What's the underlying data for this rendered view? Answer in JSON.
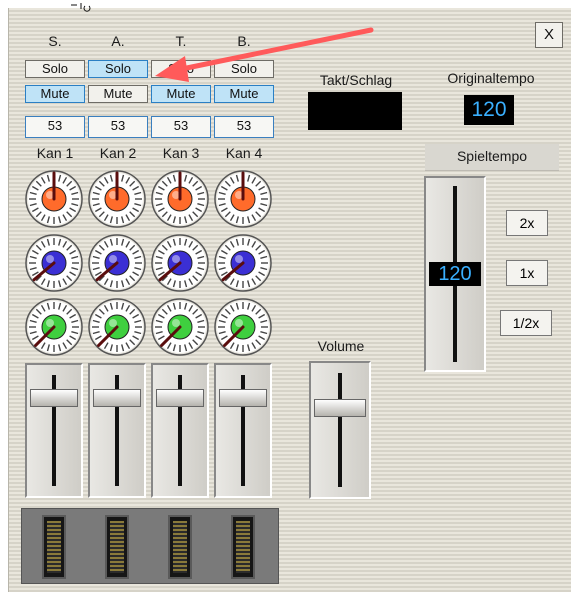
{
  "close_label": "X",
  "channels": [
    {
      "voice": "S.",
      "solo": "Solo",
      "mute": "Mute",
      "value": "53",
      "name": "Kan 1"
    },
    {
      "voice": "A.",
      "solo": "Solo",
      "mute": "Mute",
      "value": "53",
      "name": "Kan 2"
    },
    {
      "voice": "T.",
      "solo": "Solo",
      "mute": "Mute",
      "value": "53",
      "name": "Kan 3"
    },
    {
      "voice": "B.",
      "solo": "Solo",
      "mute": "Mute",
      "value": "53",
      "name": "Kan 4"
    }
  ],
  "takt_label": "Takt/Schlag",
  "takt_value": "",
  "original_tempo_label": "Originaltempo",
  "original_tempo_value": "120",
  "play_tempo_label": "Spieltempo",
  "play_tempo_value": "120",
  "tempo_buttons": [
    "2x",
    "1x",
    "1/2x"
  ],
  "volume_label": "Volume",
  "colors": {
    "knob_top": "#ff6b2b",
    "knob_mid": "#3b2fd4",
    "knob_bottom": "#3fcf3f",
    "active_button": "#bfe3f7",
    "arrow": "#ff5a5a",
    "tempo_display": "#0073c5"
  }
}
